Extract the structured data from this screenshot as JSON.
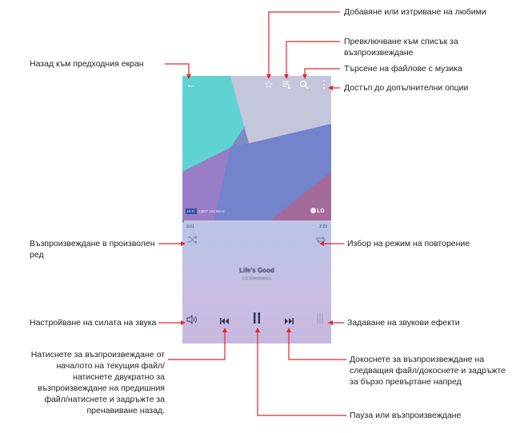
{
  "phone": {
    "top_bar": {
      "back_icon": "arrow-left-icon",
      "favorite_icon": "star-icon",
      "playlist_icon": "playlist-icon",
      "search_icon": "search-icon",
      "more_icon": "more-vertical-icon"
    },
    "album_art": {
      "hd_badge": "Hi-Fi",
      "audio_info": "24BIT 192.0KHz",
      "brand_logo": "LG"
    },
    "player": {
      "elapsed": "0:01",
      "duration": "2:23",
      "progress": 0.01,
      "song_title": "Life's Good",
      "artist": "LG Electronics",
      "shuffle_icon": "shuffle-icon",
      "repeat_icon": "repeat-icon",
      "volume_icon": "volume-icon",
      "prev_icon": "skip-previous-icon",
      "pause_icon": "pause-icon",
      "next_icon": "skip-next-icon",
      "effects_icon": "equalizer-icon"
    }
  },
  "labels": {
    "back": "Назад към предходния екран",
    "favorites": "Добавяне или изтриване на любими",
    "playlist": "Превключване към списък за възпроизвеждане",
    "search": "Търсене на файлове с музика",
    "options": "Достъп до допълнителни опции",
    "shuffle": "Възпроизвеждане в произволен ред",
    "repeat": "Избор на режим на повторение",
    "volume": "Настройване на силата на звука",
    "effects": "Задаване на звукови ефекти",
    "previous": "Натиснете за възпроизвеждане от началото на текущия файл/ натиснете двукратно за възпроизвеждане на предишния файл/натиснете и задръжте за пренавиване назад.",
    "next": "Докоснете за възпроизвеждане на следващия файл/докоснете и задръжте за бързо превъртане напред",
    "pause": "Пауза или възпроизвеждане"
  },
  "colors": {
    "callout_line": "#e3262a",
    "art_teal": "#5fd3d2",
    "art_purple": "#8a6bb8",
    "art_blue": "#5b7bd0",
    "player_bg": "#c3c0e4"
  }
}
